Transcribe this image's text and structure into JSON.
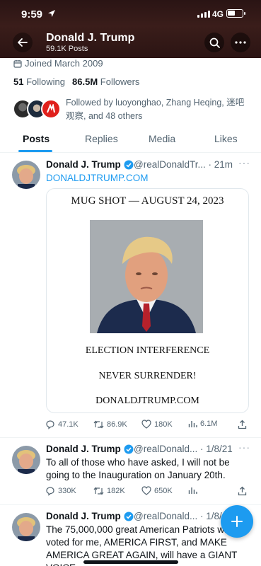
{
  "status_bar": {
    "time": "9:59",
    "network": "4G"
  },
  "header": {
    "name": "Donald J. Trump",
    "posts_count": "59.1K Posts"
  },
  "profile": {
    "joined": "Joined March 2009",
    "following_count": "51",
    "following_label": "Following",
    "followers_count": "86.5M",
    "followers_label": "Followers",
    "followed_by": "Followed by luoyonghao, Zhang Heqing, 迷吧观察, and 48 others"
  },
  "tabs": [
    {
      "label": "Posts",
      "active": true
    },
    {
      "label": "Replies"
    },
    {
      "label": "Media"
    },
    {
      "label": "Likes"
    }
  ],
  "posts": [
    {
      "name": "Donald J. Trump",
      "handle": "@realDonaldTr... · 21m",
      "text": "DONALDJTRUMP.COM",
      "card": {
        "line1": "MUG SHOT — AUGUST 24, 2023",
        "line2": "ELECTION INTERFERENCE",
        "line3": "NEVER SURRENDER!",
        "line4": "DONALDJTRUMP.COM"
      },
      "replies": "47.1K",
      "reposts": "86.9K",
      "likes": "180K",
      "views": "6.1M"
    },
    {
      "name": "Donald J. Trump",
      "handle": "@realDonald... · 1/8/21",
      "text": "To all of those who have asked, I will not be going to the Inauguration on January 20th.",
      "replies": "330K",
      "reposts": "182K",
      "likes": "650K"
    },
    {
      "name": "Donald J. Trump",
      "handle": "@realDonald... · 1/8/",
      "text": "The 75,000,000 great American Patriots who voted for me, AMERICA FIRST, and MAKE AMERICA GREAT AGAIN, will have a GIANT VOICE"
    }
  ],
  "colors": {
    "accent": "#1d9bf0",
    "verified": "#1d9bf0",
    "banner": "#3a1d1a"
  }
}
